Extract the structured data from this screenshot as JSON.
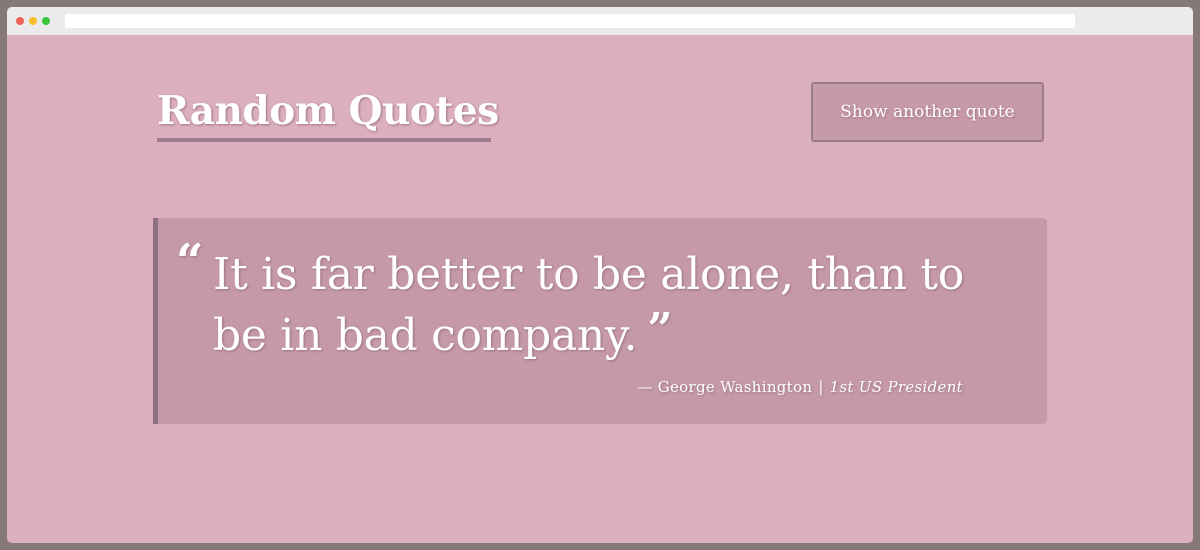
{
  "header": {
    "title": "Random Quotes",
    "new_quote_label": "Show another quote"
  },
  "quote": {
    "open_mark": "“",
    "text": "It is far better to be alone, than to be in bad company.",
    "close_mark": "”",
    "dash": "—",
    "author": "George Washington",
    "separator": "|",
    "role": "1st US President"
  },
  "colors": {
    "background": "#dbaec0",
    "quote_box": "#c599aa",
    "accent_border": "#8f7080",
    "text": "#ffffff"
  }
}
